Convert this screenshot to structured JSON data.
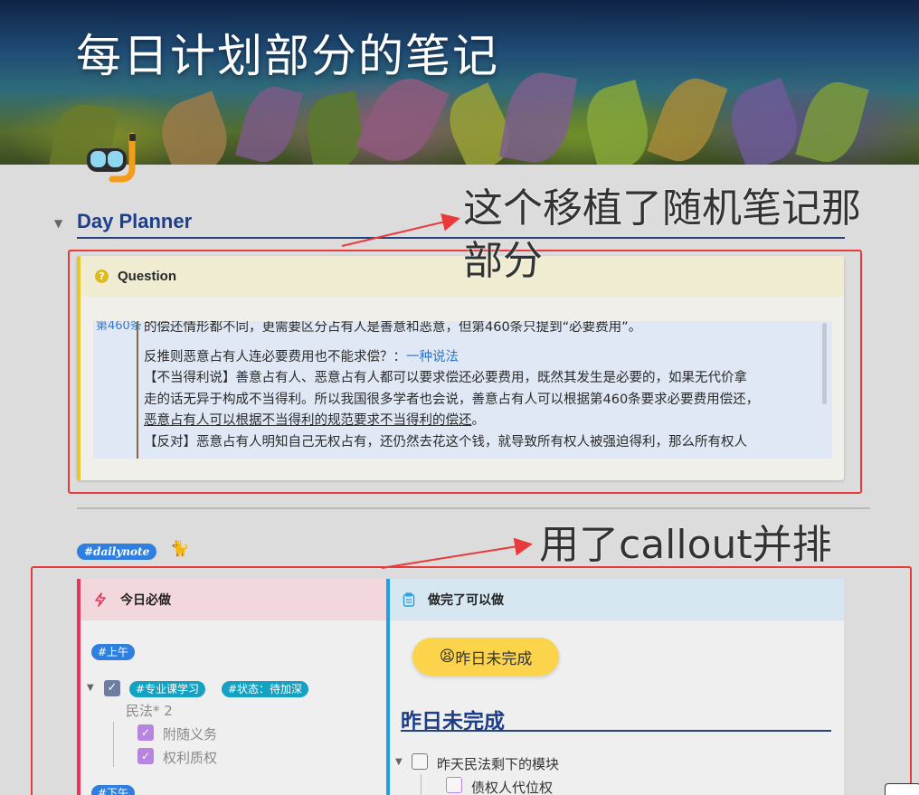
{
  "banner": {
    "title": "每日计划部分的笔记"
  },
  "page_icon": "diving-mask-icon",
  "section": {
    "heading": "Day Planner"
  },
  "annotations": {
    "top_note": "这个移植了随机笔记那部分",
    "bottom_note": "用了callout并排",
    "color": "#e83a3a"
  },
  "question_callout": {
    "title": "Question",
    "icon": "question-circle-icon",
    "cut_link": "第460条",
    "lines": {
      "l1": "的偿还情形都不同，更需要区分占有人是善意和恶意，但第460条只提到“必要费用”。",
      "l2_text": "反推则恶意占有人连必要费用也不能求偿？：",
      "l2_link": "一种说法",
      "l3": "【不当得利说】善意占有人、恶意占有人都可以要求偿还必要费用，既然其发生是必要的，如果无代价拿",
      "l4": "走的话无异于构成不当得利。所以我国很多学者也会说，善意占有人可以根据第460条要求必要费用偿还，",
      "l5": "恶意占有人可以根据不当得利的规范要求不当得利的偿还",
      "l5_end": "。",
      "l6": "【反对】恶意占有人明知自己无权占有，还仍然去花这个钱，就导致所有权人被强迫得利，那么所有权人"
    },
    "accent_color": "#e4c829"
  },
  "tag": {
    "label": "#dailynote",
    "emoji": "🐈"
  },
  "left_callout": {
    "title": "今日必做",
    "icon": "lightning-icon",
    "accent_color": "#e8365a",
    "tag_morning": "#上午",
    "task": {
      "checked": true,
      "tag1": "#专业课学习",
      "tag2": "#状态：待加深",
      "subject": "民法* 2",
      "subtasks": [
        "附随义务",
        "权利质权"
      ]
    },
    "tag_afternoon": "#下午"
  },
  "right_callout": {
    "title": "做完了可以做",
    "icon": "clipboard-icon",
    "accent_color": "#1fa0e6",
    "button_emoji": "😫",
    "button_label": "昨日未完成",
    "heading": "昨日未完成",
    "task": "昨天民法剩下的模块",
    "subtask": "债权人代位权"
  }
}
